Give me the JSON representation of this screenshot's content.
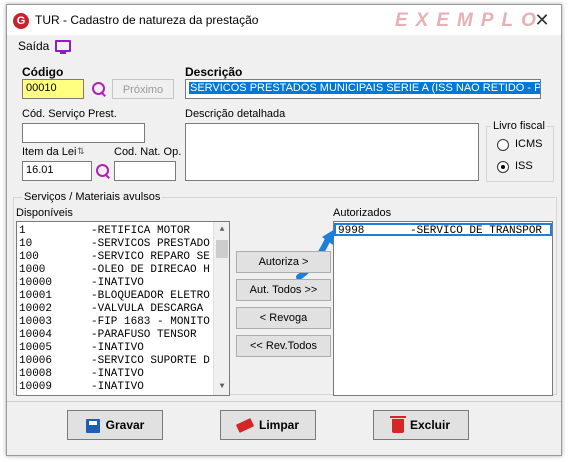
{
  "window": {
    "title": "TUR - Cadastro de natureza da prestação",
    "watermark": "EXEMPLO",
    "logo_letter": "G"
  },
  "menu": {
    "saida": "Saída"
  },
  "form": {
    "codigo_label": "Código",
    "codigo_value": "00010",
    "proximo_label": "Próximo",
    "descricao_label": "Descrição",
    "descricao_value": "SERVICOS PRESTADOS MUNICIPAIS SERIE A (ISS NAO RETIDO - PF)",
    "cod_servico_label": "Cód. Serviço Prest.",
    "cod_servico_value": "",
    "descricao_detalhada_label": "Descrição detalhada",
    "descricao_detalhada_value": "",
    "item_lei_label": "Item da Lei",
    "item_lei_value": "16.01",
    "cod_nat_op_label": "Cod. Nat. Op.",
    "cod_nat_op_value": "",
    "livro_fiscal": {
      "title": "Livro fiscal",
      "options": [
        "ICMS",
        "ISS"
      ],
      "selected": "ISS"
    }
  },
  "servicos": {
    "group_title": "Serviços  / Materiais avulsos",
    "disponiveis_label": "Disponíveis",
    "autorizados_label": "Autorizados",
    "disponiveis": [
      {
        "code": "1",
        "desc": "-RETIFICA MOTOR"
      },
      {
        "code": "10",
        "desc": "-SERVICOS PRESTADO"
      },
      {
        "code": "100",
        "desc": "-SERVICO REPARO SE"
      },
      {
        "code": "1000",
        "desc": "-OLEO DE DIRECAO H"
      },
      {
        "code": "10000",
        "desc": "-INATIVO"
      },
      {
        "code": "10001",
        "desc": "-BLOQUEADOR ELETRO"
      },
      {
        "code": "10002",
        "desc": "-VALVULA DESCARGA"
      },
      {
        "code": "10003",
        "desc": "-FIP 1683 - MONITO"
      },
      {
        "code": "10004",
        "desc": "-PARAFUSO TENSOR"
      },
      {
        "code": "10005",
        "desc": "-INATIVO"
      },
      {
        "code": "10006",
        "desc": "-SERVICO SUPORTE D"
      },
      {
        "code": "10008",
        "desc": "-INATIVO"
      },
      {
        "code": "10009",
        "desc": "-INATIVO"
      }
    ],
    "autorizados": [
      {
        "code": "9998",
        "desc": "-SERVICO DE TRANSPOR"
      }
    ],
    "buttons": {
      "autoriza": "Autoriza >",
      "aut_todos": "Aut. Todos >>",
      "revoga": "< Revoga",
      "rev_todos": "<< Rev.Todos"
    }
  },
  "footer": {
    "gravar": "Gravar",
    "limpar": "Limpar",
    "excluir": "Excluir"
  },
  "colors": {
    "accent_selection": "#0078d7",
    "codigo_bg": "#ffff80",
    "icon_purple": "#b21fb8",
    "arrow_blue": "#1e7fd8"
  }
}
